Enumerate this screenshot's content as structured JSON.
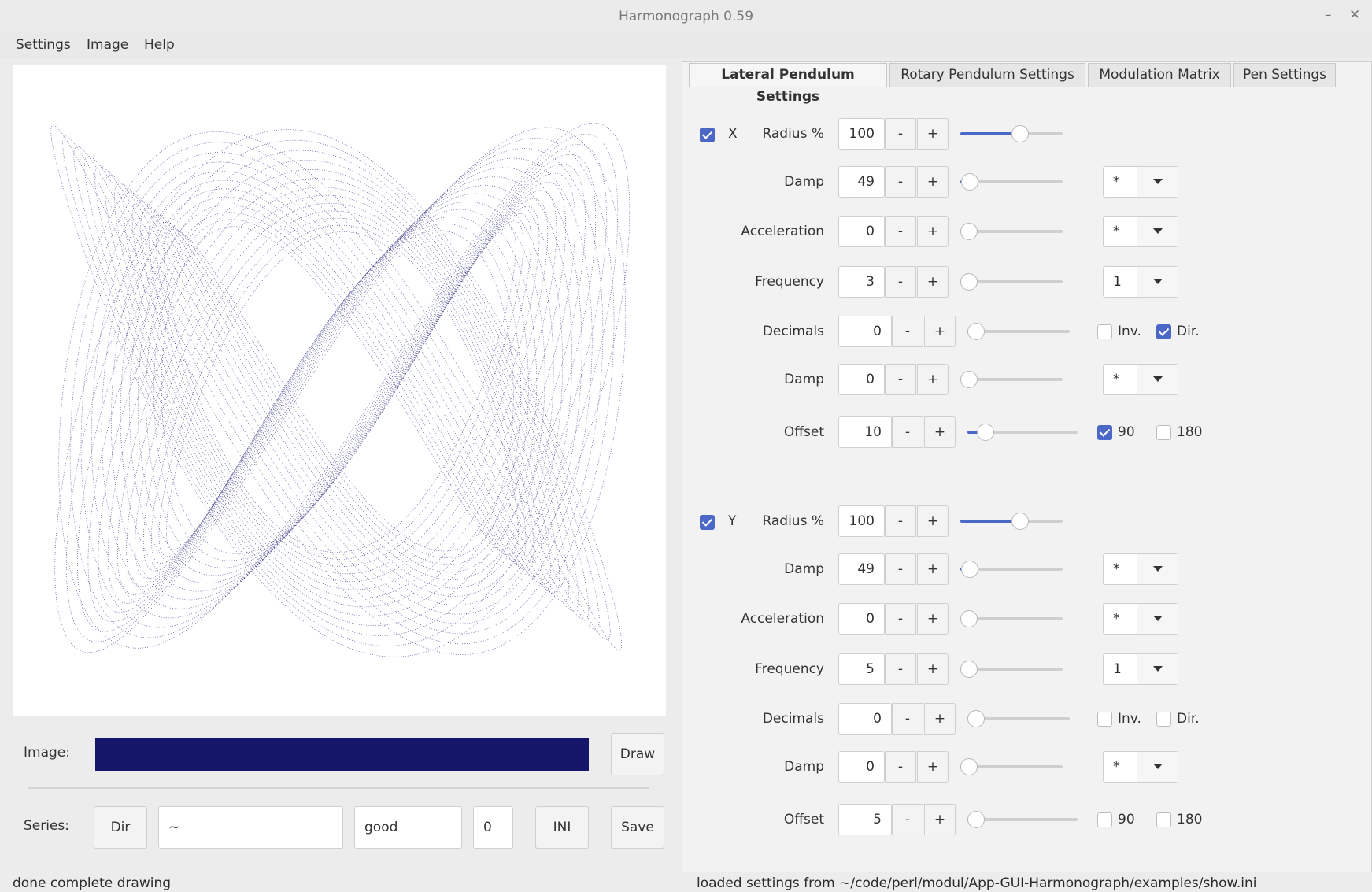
{
  "window": {
    "title": "Harmonograph 0.59",
    "minimize": "–",
    "close": "✕"
  },
  "menu": [
    "Settings",
    "Image",
    "Help"
  ],
  "left": {
    "image_label": "Image:",
    "draw_label": "Draw",
    "series_label": "Series:",
    "dir_label": "Dir",
    "dir_value": "~",
    "name_value": "good",
    "index_value": "0",
    "ini_label": "INI",
    "save_label": "Save",
    "progress_fraction": 1.0,
    "status": "done complete drawing"
  },
  "tabs": [
    "Lateral Pendulum Settings",
    "Rotary Pendulum Settings",
    "Modulation Matrix",
    "Pen Settings"
  ],
  "active_tab": "Lateral Pendulum Settings",
  "pendulums": [
    {
      "name": "X",
      "enabled": true,
      "rows": [
        {
          "label": "Radius %",
          "value": "100",
          "slider": 0.6
        },
        {
          "label": "Damp",
          "value": "49",
          "slider": 0.01,
          "combo": "*"
        },
        {
          "label": "Acceleration",
          "value": "0",
          "slider": 0.0,
          "combo": "*"
        },
        {
          "label": "Frequency",
          "value": "3",
          "slider": 0.0,
          "combo": "1"
        },
        {
          "label": "Decimals",
          "value": "0",
          "slider": 0.0,
          "checks": [
            {
              "label": "Inv.",
              "checked": false
            },
            {
              "label": "Dir.",
              "checked": true
            }
          ]
        },
        {
          "label": "Damp",
          "value": "0",
          "slider": 0.0,
          "combo": "*"
        },
        {
          "label": "Offset",
          "value": "10",
          "slider": 0.1,
          "checks": [
            {
              "label": "90",
              "checked": true
            },
            {
              "label": "180",
              "checked": false
            }
          ]
        }
      ]
    },
    {
      "name": "Y",
      "enabled": true,
      "rows": [
        {
          "label": "Radius %",
          "value": "100",
          "slider": 0.6
        },
        {
          "label": "Damp",
          "value": "49",
          "slider": 0.01,
          "combo": "*"
        },
        {
          "label": "Acceleration",
          "value": "0",
          "slider": 0.0,
          "combo": "*"
        },
        {
          "label": "Frequency",
          "value": "5",
          "slider": 0.0,
          "combo": "1"
        },
        {
          "label": "Decimals",
          "value": "0",
          "slider": 0.0,
          "checks": [
            {
              "label": "Inv.",
              "checked": false
            },
            {
              "label": "Dir.",
              "checked": false
            }
          ]
        },
        {
          "label": "Damp",
          "value": "0",
          "slider": 0.0,
          "combo": "*"
        },
        {
          "label": "Offset",
          "value": "5",
          "slider": 0.0,
          "checks": [
            {
              "label": "90",
              "checked": false
            },
            {
              "label": "180",
              "checked": false
            }
          ]
        }
      ]
    }
  ],
  "right_status": "loaded settings from ~/code/perl/modul/App-GUI-Harmonograph/examples/show.ini",
  "colors": {
    "accent": "#4c68c6",
    "pen": "#1a1a78",
    "progress": "#15166a"
  }
}
